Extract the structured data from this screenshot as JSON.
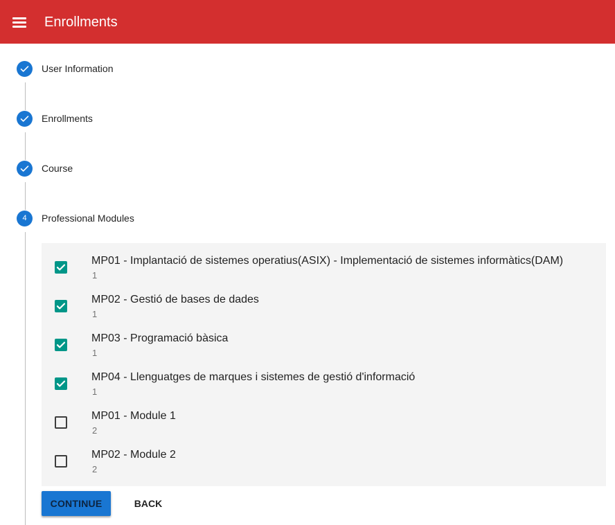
{
  "appbar": {
    "title": "Enrollments",
    "menu_icon": "menu-icon",
    "color": "#d32f2f"
  },
  "stepper": {
    "accent": "#1976d2",
    "steps": [
      {
        "label": "User Information",
        "state": "completed",
        "icon": "check-icon"
      },
      {
        "label": "Enrollments",
        "state": "completed",
        "icon": "check-icon"
      },
      {
        "label": "Course",
        "state": "completed",
        "icon": "check-icon"
      },
      {
        "label": "Professional Modules",
        "state": "active",
        "number": "4"
      }
    ]
  },
  "modules": {
    "checkbox_color": "#009688",
    "items": [
      {
        "title": "MP01 - Implantació de sistemes operatius(ASIX) - Implementació de sistemes informàtics(DAM)",
        "subtitle": "1",
        "checked": true
      },
      {
        "title": "MP02 - Gestió de bases de dades",
        "subtitle": "1",
        "checked": true
      },
      {
        "title": "MP03 - Programació bàsica",
        "subtitle": "1",
        "checked": true
      },
      {
        "title": "MP04 - Llenguatges de marques i sistemes de gestió d'informació",
        "subtitle": "1",
        "checked": true
      },
      {
        "title": "MP01 - Module 1",
        "subtitle": "2",
        "checked": false
      },
      {
        "title": "MP02 - Module 2",
        "subtitle": "2",
        "checked": false
      }
    ]
  },
  "actions": {
    "continue_label": "CONTINUE",
    "back_label": "BACK"
  }
}
